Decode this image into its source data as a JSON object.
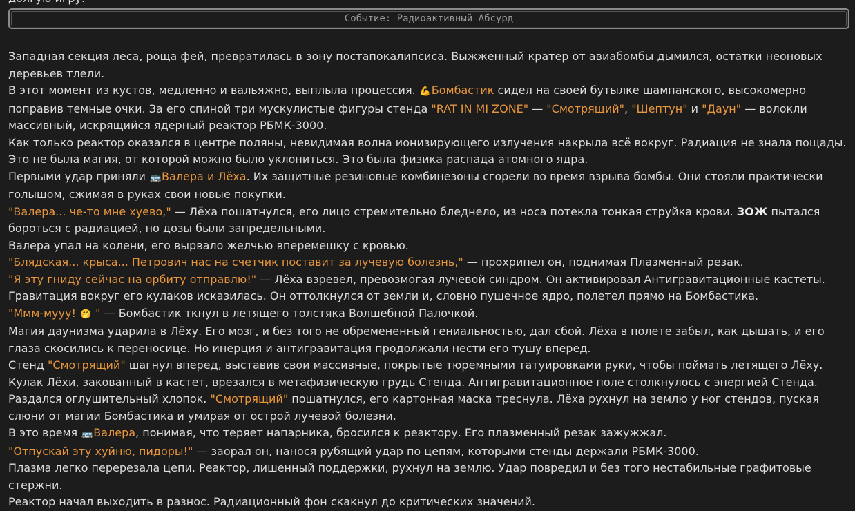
{
  "top_fragment": "долгую игру.",
  "event_title": "Событие: Радиоактивный Абсурд",
  "icons": {
    "emoji_1": "💪",
    "emoji_2": "🚌",
    "emoji_3": "🤭",
    "emoji_4": "🚌"
  },
  "p1": "Западная секция леса, роща фей, превратилась в зону постапокалипсиса. Выжженный кратер от авиабомбы дымился, остатки неоновых деревьев тлели.",
  "p2": {
    "a": "В этот момент из кустов, медленно и вальяжно, выплыла процессия. ",
    "name": "Бомбастик",
    "b": " сидел на своей бутылке шампанского, высокомерно поправив темные очки. За его спиной три мускулистые фигуры стенда ",
    "s1": "\"RAT IN MI ZONE\"",
    "c": " — ",
    "s2": "\"Смотрящий\"",
    "d": ", ",
    "s3": "\"Шептун\"",
    "e": " и ",
    "s4": "\"Даун\"",
    "f": " — волокли массивный, искрящийся ядерный реактор РБМК-3000."
  },
  "p3": "Как только реактор оказался в центре поляны, невидимая волна ионизирующего излучения накрыла всё вокруг. Радиация не знала пощады. Это не была магия, от которой можно было уклониться. Это была физика распада атомного ядра.",
  "p4": {
    "a": "Первыми удар приняли ",
    "names": "Валера и Лёха",
    "b": ". Их защитные резиновые комбинезоны сгорели во время взрыва бомбы. Они стояли практически голышом, сжимая в руках свои новые покупки."
  },
  "p5": {
    "quote": "\"Валера... че-то мне хуево,\"",
    "a": " — Лёха пошатнулся, его лицо стремительно бледнело, из носа потекла тонкая струйка крови. ",
    "bold": "ЗОЖ",
    "b": " пытался бороться с радиацией, но дозы были запредельными."
  },
  "p6": "Валера упал на колени, его вырвало желчью вперемешку с кровью.",
  "p7": {
    "quote": "\"Блядская... крыса... Петрович нас на счетчик поставит за лучевую болезнь,\"",
    "a": " — прохрипел он, поднимая Плазменный резак."
  },
  "p8": {
    "quote": "\"Я эту гниду сейчас на орбиту отправлю!\"",
    "a": " — Лёха взревел, превозмогая лучевой синдром. Он активировал Антигравитационные кастеты."
  },
  "p9": "Гравитация вокруг его кулаков исказилась. Он оттолкнулся от земли и, словно пушечное ядро, полетел прямо на Бомбастика.",
  "p10": {
    "quote_a": "\"Ммм-мууу! ",
    "quote_b": " \"",
    "a": " — Бомбастик ткнул в летящего толстяка Волшебной Палочкой."
  },
  "p11": "Магия даунизма ударила в Лёху. Его мозг, и без того не обремененный гениальностью, дал сбой. Лёха в полете забыл, как дышать, и его глаза скосились к переносице. Но инерция и антигравитация продолжали нести его тушу вперед.",
  "p12": {
    "a": "Стенд ",
    "s1": "\"Смотрящий\"",
    "b": " шагнул вперед, выставив свои массивные, покрытые тюремными татуировками руки, чтобы поймать летящего Лёху. Кулак Лёхи, закованный в кастет, врезался в метафизическую грудь Стенда. Антигравитационное поле столкнулось с энергией Стенда. Раздался оглушительный хлопок. ",
    "s2": "\"Смотрящий\"",
    "c": " пошатнулся, его картонная маска треснула. Лёха рухнул на землю у ног стендов, пуская слюни от магии Бомбастика и умирая от острой лучевой болезни."
  },
  "p13": {
    "a": "В это время ",
    "name": "Валера",
    "b": ", понимая, что теряет напарника, бросился к реактору. Его плазменный резак зажужжал."
  },
  "p14": {
    "quote": "\"Отпускай эту хуйню, пидоры!\"",
    "a": " — заорал он, нанося рубящий удар по цепям, которыми стенды держали РБМК-3000."
  },
  "p15": "Плазма легко перерезала цепи. Реактор, лишенный поддержки, рухнул на землю. Удар повредил и без того нестабильные графитовые стержни.",
  "p16": "Реактор начал выходить в разнос. Радиационный фон скакнул до критических значений."
}
